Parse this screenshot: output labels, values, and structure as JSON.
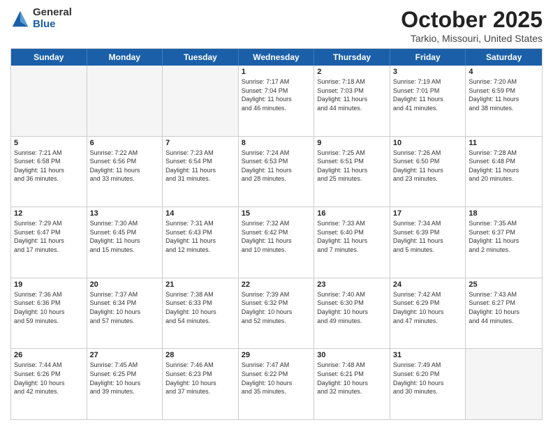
{
  "logo": {
    "general": "General",
    "blue": "Blue"
  },
  "title": "October 2025",
  "subtitle": "Tarkio, Missouri, United States",
  "dayHeaders": [
    "Sunday",
    "Monday",
    "Tuesday",
    "Wednesday",
    "Thursday",
    "Friday",
    "Saturday"
  ],
  "weeks": [
    [
      {
        "day": "",
        "info": ""
      },
      {
        "day": "",
        "info": ""
      },
      {
        "day": "",
        "info": ""
      },
      {
        "day": "1",
        "info": "Sunrise: 7:17 AM\nSunset: 7:04 PM\nDaylight: 11 hours\nand 46 minutes."
      },
      {
        "day": "2",
        "info": "Sunrise: 7:18 AM\nSunset: 7:03 PM\nDaylight: 11 hours\nand 44 minutes."
      },
      {
        "day": "3",
        "info": "Sunrise: 7:19 AM\nSunset: 7:01 PM\nDaylight: 11 hours\nand 41 minutes."
      },
      {
        "day": "4",
        "info": "Sunrise: 7:20 AM\nSunset: 6:59 PM\nDaylight: 11 hours\nand 38 minutes."
      }
    ],
    [
      {
        "day": "5",
        "info": "Sunrise: 7:21 AM\nSunset: 6:58 PM\nDaylight: 11 hours\nand 36 minutes."
      },
      {
        "day": "6",
        "info": "Sunrise: 7:22 AM\nSunset: 6:56 PM\nDaylight: 11 hours\nand 33 minutes."
      },
      {
        "day": "7",
        "info": "Sunrise: 7:23 AM\nSunset: 6:54 PM\nDaylight: 11 hours\nand 31 minutes."
      },
      {
        "day": "8",
        "info": "Sunrise: 7:24 AM\nSunset: 6:53 PM\nDaylight: 11 hours\nand 28 minutes."
      },
      {
        "day": "9",
        "info": "Sunrise: 7:25 AM\nSunset: 6:51 PM\nDaylight: 11 hours\nand 25 minutes."
      },
      {
        "day": "10",
        "info": "Sunrise: 7:26 AM\nSunset: 6:50 PM\nDaylight: 11 hours\nand 23 minutes."
      },
      {
        "day": "11",
        "info": "Sunrise: 7:28 AM\nSunset: 6:48 PM\nDaylight: 11 hours\nand 20 minutes."
      }
    ],
    [
      {
        "day": "12",
        "info": "Sunrise: 7:29 AM\nSunset: 6:47 PM\nDaylight: 11 hours\nand 17 minutes."
      },
      {
        "day": "13",
        "info": "Sunrise: 7:30 AM\nSunset: 6:45 PM\nDaylight: 11 hours\nand 15 minutes."
      },
      {
        "day": "14",
        "info": "Sunrise: 7:31 AM\nSunset: 6:43 PM\nDaylight: 11 hours\nand 12 minutes."
      },
      {
        "day": "15",
        "info": "Sunrise: 7:32 AM\nSunset: 6:42 PM\nDaylight: 11 hours\nand 10 minutes."
      },
      {
        "day": "16",
        "info": "Sunrise: 7:33 AM\nSunset: 6:40 PM\nDaylight: 11 hours\nand 7 minutes."
      },
      {
        "day": "17",
        "info": "Sunrise: 7:34 AM\nSunset: 6:39 PM\nDaylight: 11 hours\nand 5 minutes."
      },
      {
        "day": "18",
        "info": "Sunrise: 7:35 AM\nSunset: 6:37 PM\nDaylight: 11 hours\nand 2 minutes."
      }
    ],
    [
      {
        "day": "19",
        "info": "Sunrise: 7:36 AM\nSunset: 6:36 PM\nDaylight: 10 hours\nand 59 minutes."
      },
      {
        "day": "20",
        "info": "Sunrise: 7:37 AM\nSunset: 6:34 PM\nDaylight: 10 hours\nand 57 minutes."
      },
      {
        "day": "21",
        "info": "Sunrise: 7:38 AM\nSunset: 6:33 PM\nDaylight: 10 hours\nand 54 minutes."
      },
      {
        "day": "22",
        "info": "Sunrise: 7:39 AM\nSunset: 6:32 PM\nDaylight: 10 hours\nand 52 minutes."
      },
      {
        "day": "23",
        "info": "Sunrise: 7:40 AM\nSunset: 6:30 PM\nDaylight: 10 hours\nand 49 minutes."
      },
      {
        "day": "24",
        "info": "Sunrise: 7:42 AM\nSunset: 6:29 PM\nDaylight: 10 hours\nand 47 minutes."
      },
      {
        "day": "25",
        "info": "Sunrise: 7:43 AM\nSunset: 6:27 PM\nDaylight: 10 hours\nand 44 minutes."
      }
    ],
    [
      {
        "day": "26",
        "info": "Sunrise: 7:44 AM\nSunset: 6:26 PM\nDaylight: 10 hours\nand 42 minutes."
      },
      {
        "day": "27",
        "info": "Sunrise: 7:45 AM\nSunset: 6:25 PM\nDaylight: 10 hours\nand 39 minutes."
      },
      {
        "day": "28",
        "info": "Sunrise: 7:46 AM\nSunset: 6:23 PM\nDaylight: 10 hours\nand 37 minutes."
      },
      {
        "day": "29",
        "info": "Sunrise: 7:47 AM\nSunset: 6:22 PM\nDaylight: 10 hours\nand 35 minutes."
      },
      {
        "day": "30",
        "info": "Sunrise: 7:48 AM\nSunset: 6:21 PM\nDaylight: 10 hours\nand 32 minutes."
      },
      {
        "day": "31",
        "info": "Sunrise: 7:49 AM\nSunset: 6:20 PM\nDaylight: 10 hours\nand 30 minutes."
      },
      {
        "day": "",
        "info": ""
      }
    ]
  ]
}
